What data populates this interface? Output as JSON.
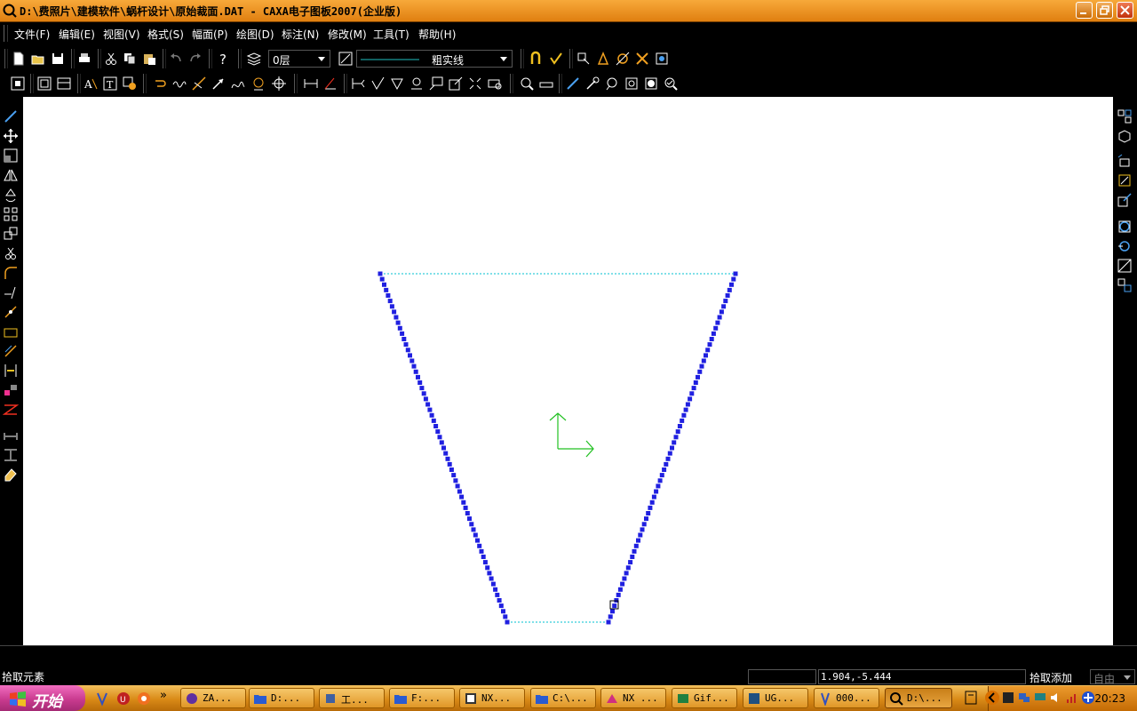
{
  "window": {
    "title": "D:\\费照片\\建模软件\\蜗杆设计\\原始裁面.DAT - CAXA电子图板2007(企业版)"
  },
  "menu": [
    "文件(F)",
    "编辑(E)",
    "视图(V)",
    "格式(S)",
    "幅面(P)",
    "绘图(D)",
    "标注(N)",
    "修改(M)",
    "工具(T)",
    "帮助(H)"
  ],
  "toolbar": {
    "layer_value": "0层",
    "linetype_value": "粗实线"
  },
  "status": {
    "prompt": "拾取元素",
    "coords": "1.904,-5.444",
    "mode": "拾取添加",
    "snap": "自由"
  },
  "taskbar": {
    "start_label": "开始",
    "more": "»",
    "tasks": [
      "ZA...",
      "D:...",
      "工...",
      "F:...",
      "NX...",
      "C:\\...",
      "NX ...",
      "Gif...",
      "UG...",
      "000...",
      "D:\\..."
    ],
    "clock": "20:23"
  },
  "colors": {
    "accent_orange": "#f0a030",
    "drawing_points": "#2020e0",
    "drawing_dotted": "#00c0d0",
    "axis": "#20c020"
  }
}
